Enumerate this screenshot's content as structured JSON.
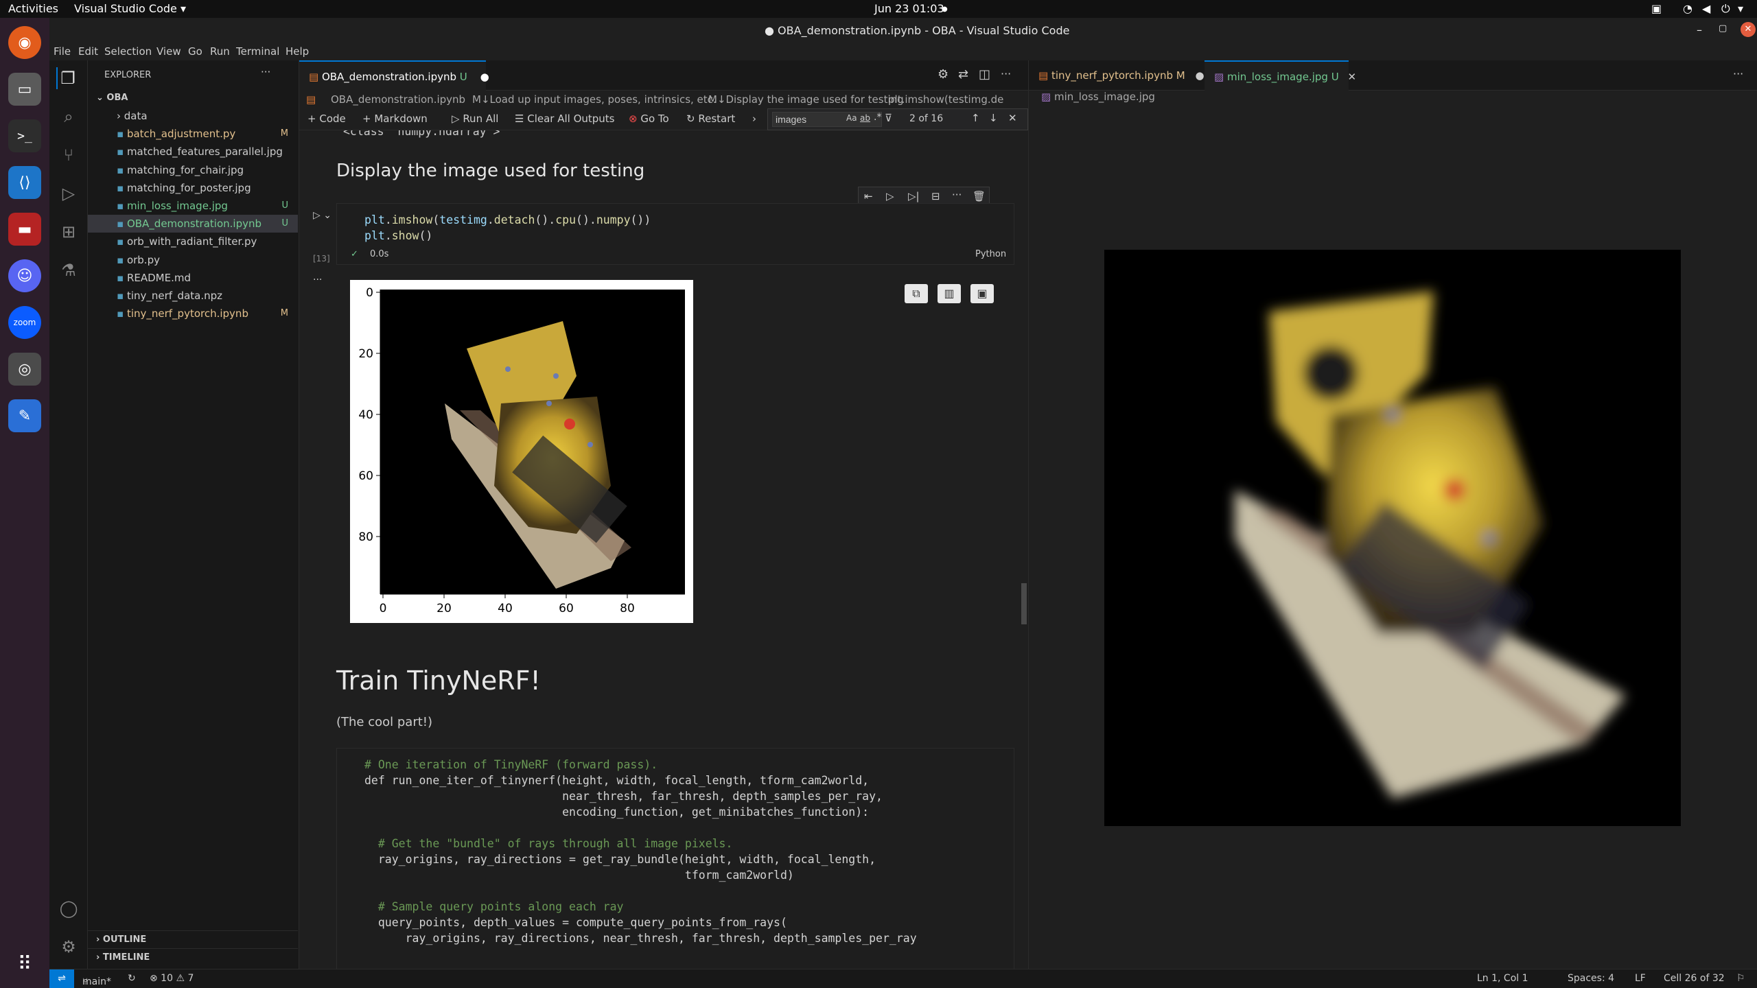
{
  "topbar": {
    "activities": "Activities",
    "app": "Visual Studio Code ▾",
    "clock": "Jun 23  01:03"
  },
  "window": {
    "title": "● OBA_demonstration.ipynb - OBA - Visual Studio Code"
  },
  "menu": [
    "File",
    "Edit",
    "Selection",
    "View",
    "Go",
    "Run",
    "Terminal",
    "Help"
  ],
  "explorer": {
    "header": "EXPLORER",
    "root": "OBA",
    "items": [
      {
        "name": "data",
        "badge": ""
      },
      {
        "name": "batch_adjustment.py",
        "badge": "M"
      },
      {
        "name": "matched_features_parallel.jpg",
        "badge": ""
      },
      {
        "name": "matching_for_chair.jpg",
        "badge": ""
      },
      {
        "name": "matching_for_poster.jpg",
        "badge": ""
      },
      {
        "name": "min_loss_image.jpg",
        "badge": "U"
      },
      {
        "name": "OBA_demonstration.ipynb",
        "badge": "U"
      },
      {
        "name": "orb_with_radiant_filter.py",
        "badge": ""
      },
      {
        "name": "orb.py",
        "badge": ""
      },
      {
        "name": "README.md",
        "badge": ""
      },
      {
        "name": "tiny_nerf_data.npz",
        "badge": ""
      },
      {
        "name": "tiny_nerf_pytorch.ipynb",
        "badge": "M"
      }
    ],
    "outline": "OUTLINE",
    "timeline": "TIMELINE"
  },
  "editor1": {
    "tab": {
      "name": "OBA_demonstration.ipynb",
      "badge": "U"
    },
    "breadcrumb": [
      "OBA_demonstration.ipynb",
      "M↓Load up input images, poses, intrinsics, etc.",
      "M↓Display the image used for testing",
      "plt.imshow(testimg.de"
    ],
    "toolbar": {
      "code": "Code",
      "markdown": "Markdown",
      "run_all": "Run All",
      "clear": "Clear All Outputs",
      "goto": "Go To",
      "restart": "Restart"
    },
    "find": {
      "query": "images",
      "count": "2 of 16",
      "aa": "Aa",
      "ab": "ab",
      "regex": ".*"
    },
    "cells": {
      "prev_output": "<class 'numpy.ndarray'>",
      "heading1": "Display the image used for testing",
      "code1_line1": "plt.imshow(testimg.detach().cpu().numpy())",
      "code1_line2": "plt.show()",
      "exec_count": "[13]",
      "exec_time": "0.0s",
      "lang": "Python",
      "plot_yticks": [
        "0",
        "20",
        "40",
        "60",
        "80"
      ],
      "plot_xticks": [
        "0",
        "20",
        "40",
        "60",
        "80"
      ],
      "heading2": "Train TinyNeRF!",
      "paragraph": "(The cool part!)",
      "code2": [
        "# One iteration of TinyNeRF (forward pass).",
        "def run_one_iter_of_tinynerf(height, width, focal_length, tform_cam2world,",
        "                             near_thresh, far_thresh, depth_samples_per_ray,",
        "                             encoding_function, get_minibatches_function):",
        "",
        "  # Get the \"bundle\" of rays through all image pixels.",
        "  ray_origins, ray_directions = get_ray_bundle(height, width, focal_length,",
        "                                               tform_cam2world)",
        "",
        "  # Sample query points along each ray",
        "  query_points, depth_values = compute_query_points_from_rays(",
        "      ray_origins, ray_directions, near_thresh, far_thresh, depth_samples_per_ray"
      ]
    }
  },
  "editor2": {
    "tabs": [
      {
        "name": "tiny_nerf_pytorch.ipynb",
        "badge": "M"
      },
      {
        "name": "min_loss_image.jpg",
        "badge": "U"
      }
    ],
    "breadcrumb": "min_loss_image.jpg"
  },
  "status": {
    "branch": "main*",
    "problems": "⊗ 10 ⚠ 7",
    "position": "Ln 1, Col 1",
    "spaces": "Spaces: 4",
    "eol": "LF",
    "cell": "Cell 26 of 32"
  },
  "colors": {
    "accent": "#0078d4",
    "modified": "#e2c08d",
    "untracked": "#73c991"
  }
}
